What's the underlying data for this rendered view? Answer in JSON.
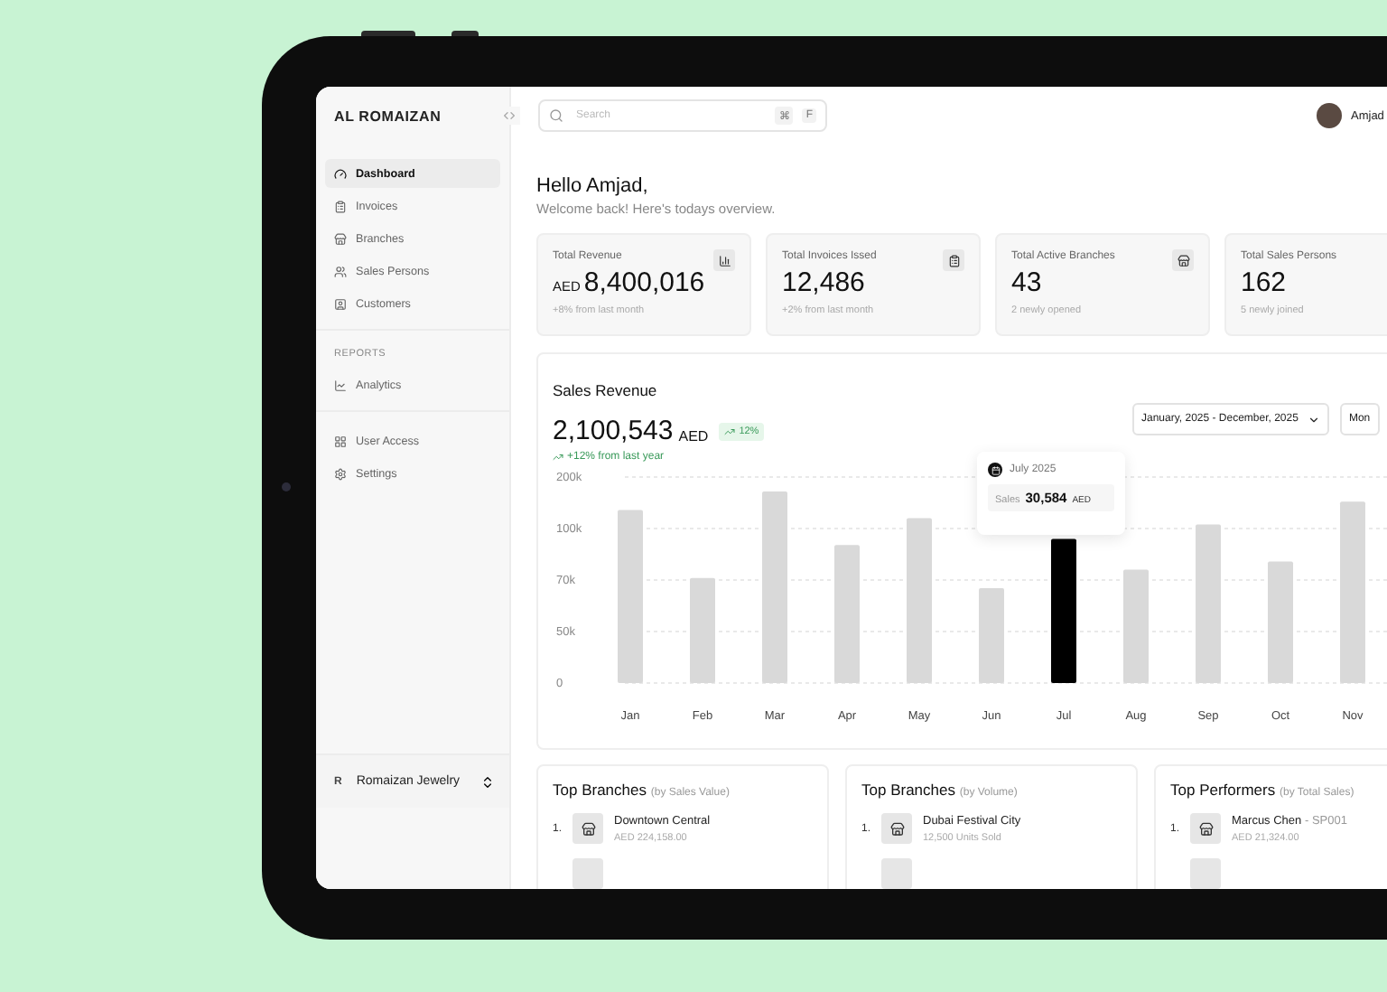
{
  "sidebar": {
    "brand": "AL ROMAIZAN",
    "nav": [
      {
        "label": "Dashboard",
        "selected": true
      },
      {
        "label": "Invoices",
        "selected": false
      },
      {
        "label": "Branches",
        "selected": false
      },
      {
        "label": "Sales Persons",
        "selected": false
      },
      {
        "label": "Customers",
        "selected": false
      }
    ],
    "reports_heading": "REPORTS",
    "reports": [
      {
        "label": "Analytics",
        "selected": false
      }
    ],
    "system": [
      {
        "label": "User Access",
        "selected": false
      },
      {
        "label": "Settings",
        "selected": false
      }
    ],
    "workspace": {
      "initial": "R",
      "name": "Romaizan Jewelry"
    }
  },
  "header": {
    "search": {
      "placeholder": "Search",
      "shortcut": [
        "⌘",
        "F"
      ]
    },
    "user": {
      "name": "Amjad"
    }
  },
  "greeting": {
    "title": "Hello Amjad,",
    "subtitle": "Welcome back! Here's todays overview."
  },
  "stats": [
    {
      "label": "Total Revenue",
      "prefix": "AED",
      "value": "8,400,016",
      "note": "+8% from last month"
    },
    {
      "label": "Total Invoices Issed",
      "value": "12,486",
      "note": "+2% from last month"
    },
    {
      "label": "Total Active Branches",
      "value": "43",
      "note": "2 newly opened"
    },
    {
      "label": "Total Sales Persons",
      "value": "162",
      "note": "5 newly joined"
    }
  ],
  "sales_revenue": {
    "title": "Sales Revenue",
    "total": "2,100,543",
    "unit": "AED",
    "badge": "12%",
    "trend": "+12% from last year",
    "date_range": "January, 2025 - December, 2025",
    "period": "Mon",
    "tooltip": {
      "date": "July 2025",
      "label": "Sales",
      "value": "30,584",
      "unit": "AED"
    },
    "bars": [
      {
        "selected": false
      },
      {
        "selected": false
      },
      {
        "selected": false
      },
      {
        "selected": false
      },
      {
        "selected": false
      },
      {
        "selected": false
      },
      {
        "selected": true
      },
      {
        "selected": false
      },
      {
        "selected": false
      },
      {
        "selected": false
      },
      {
        "selected": false
      }
    ],
    "axis_labels": [
      "200k",
      "100k",
      "70k",
      "50k",
      "0"
    ],
    "months": [
      "Jan",
      "Feb",
      "Mar",
      "Apr",
      "May",
      "Jun",
      "Jul",
      "Aug",
      "Sep",
      "Oct",
      "Nov"
    ]
  },
  "top_lists": [
    {
      "title": "Top Branches",
      "qualifier": "(by Sales Value)",
      "items": [
        {
          "rank": "1.",
          "name": "Downtown Central",
          "sub": "AED 224,158.00"
        }
      ]
    },
    {
      "title": "Top Branches",
      "qualifier": "(by Volume)",
      "items": [
        {
          "rank": "1.",
          "name": "Dubai Festival City",
          "sub": "12,500 Units Sold"
        }
      ]
    },
    {
      "title": "Top Performers",
      "qualifier": "(by Total Sales)",
      "items": [
        {
          "rank": "1.",
          "name": "Marcus Chen",
          "code": "- SP001",
          "sub": "AED 21,324.00"
        }
      ]
    }
  ]
}
